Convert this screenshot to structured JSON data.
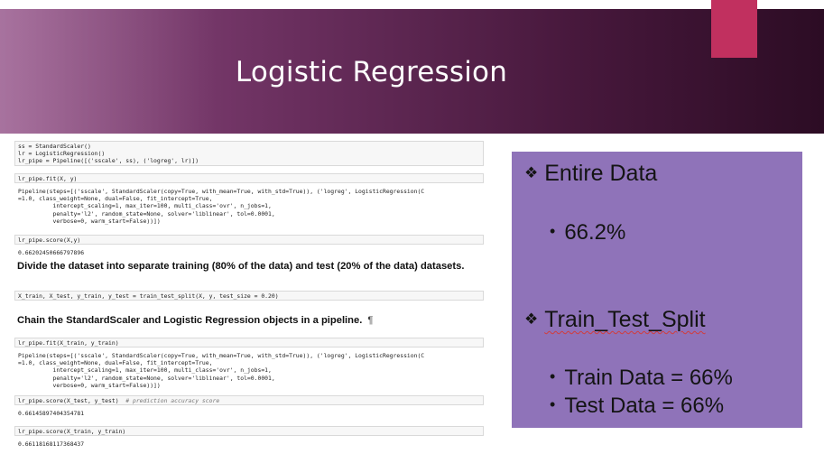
{
  "slide": {
    "title": "Logistic Regression",
    "colors": {
      "banner": "#5a2450",
      "accent": "#c1305f",
      "panel": "#8f73b9"
    }
  },
  "notebook": {
    "cell1": [
      "ss = StandardScaler()",
      "lr = LogisticRegression()",
      "lr_pipe = Pipeline([('sscale', ss), ('logreg', lr)])"
    ],
    "cell2": "lr_pipe.fit(X, y)",
    "out2": [
      "Pipeline(steps=[('sscale', StandardScaler(copy=True, with_mean=True, with_std=True)), ('logreg', LogisticRegression(C",
      "=1.0, class_weight=None, dual=False, fit_intercept=True,",
      "          intercept_scaling=1, max_iter=100, multi_class='ovr', n_jobs=1,",
      "          penalty='l2', random_state=None, solver='liblinear', tol=0.0001,",
      "          verbose=0, warm_start=False))])"
    ],
    "cell3": "lr_pipe.score(X,y)",
    "out3": "0.66202450666797896",
    "md1": "Divide the dataset into separate training (80% of the data) and test (20% of the data) datasets.",
    "cell4": "X_train, X_test, y_train, y_test = train_test_split(X, y, test_size = 0.20)",
    "md2": "Chain the StandardScaler and Logistic Regression objects in a pipeline.",
    "md2_mark": "¶",
    "cell5": "lr_pipe.fit(X_train, y_train)",
    "out5": [
      "Pipeline(steps=[('sscale', StandardScaler(copy=True, with_mean=True, with_std=True)), ('logreg', LogisticRegression(C",
      "=1.0, class_weight=None, dual=False, fit_intercept=True,",
      "          intercept_scaling=1, max_iter=100, multi_class='ovr', n_jobs=1,",
      "          penalty='l2', random_state=None, solver='liblinear', tol=0.0001,",
      "          verbose=0, warm_start=False))])"
    ],
    "cell6_code": "lr_pipe.score(X_test, y_test)",
    "cell6_comment": "# prediction accuracy score",
    "out6": "0.66145897404354781",
    "cell7": "lr_pipe.score(X_train, y_train)",
    "out7": "0.66118168117368437"
  },
  "panel": {
    "bullet_icon": "diamond-bullet-icon",
    "heading1": "Entire Data",
    "item1": "66.2%",
    "heading2": "Train_Test_Split",
    "item2": "Train Data = 66%",
    "item3": "Test Data = 66%"
  }
}
